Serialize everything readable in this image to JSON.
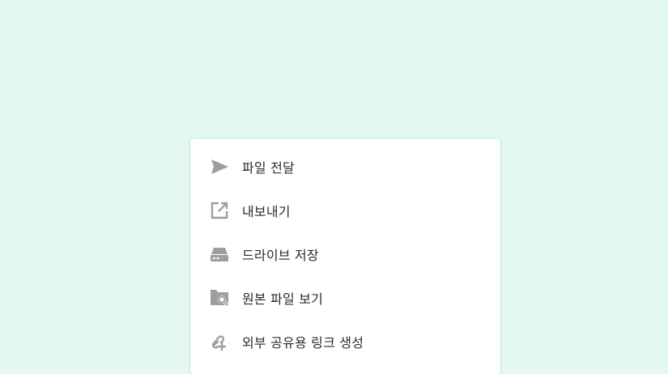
{
  "menu": {
    "items": [
      {
        "icon": "send-icon",
        "label": "파일 전달"
      },
      {
        "icon": "export-icon",
        "label": "내보내기"
      },
      {
        "icon": "drive-icon",
        "label": "드라이브 저장"
      },
      {
        "icon": "folder-search-icon",
        "label": "원본 파일 보기"
      },
      {
        "icon": "link-add-icon",
        "label": "외부 공유용 링크 생성"
      }
    ]
  },
  "colors": {
    "background": "#e3f8ef",
    "card": "#ffffff",
    "icon": "#9e9e9e",
    "text": "#2b2b2b"
  }
}
